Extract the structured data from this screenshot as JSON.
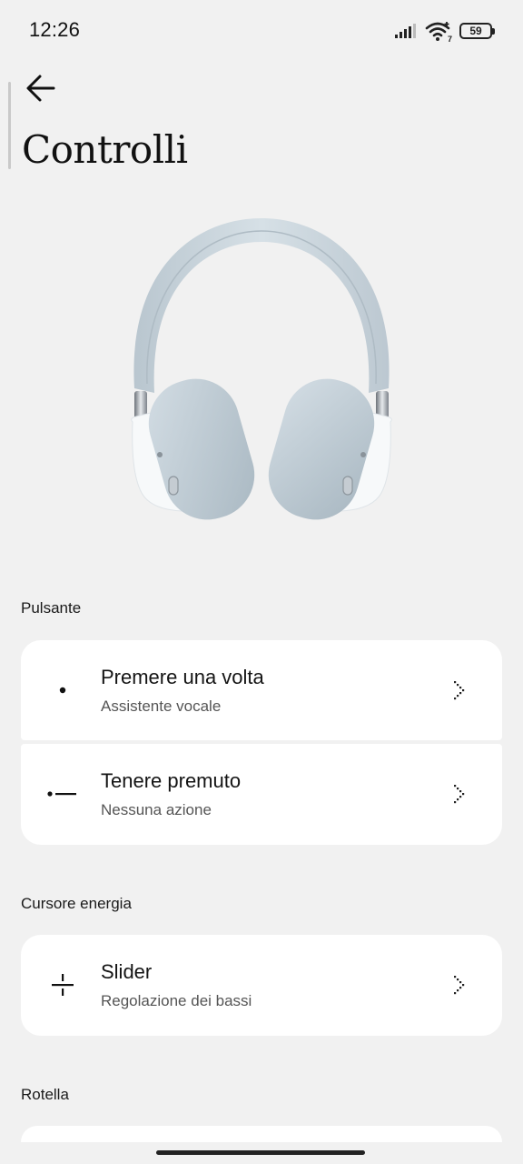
{
  "status_bar": {
    "time": "12:26",
    "battery_level": "59",
    "wifi_badge": "7"
  },
  "header": {
    "title": "Controlli"
  },
  "sections": {
    "button": {
      "label": "Pulsante",
      "items": [
        {
          "title": "Premere una volta",
          "subtitle": "Assistente vocale",
          "icon": "single-dot-icon"
        },
        {
          "title": "Tenere premuto",
          "subtitle": "Nessuna azione",
          "icon": "dot-dash-icon"
        }
      ]
    },
    "energy_slider": {
      "label": "Cursore energia",
      "items": [
        {
          "title": "Slider",
          "subtitle": "Regolazione dei bassi",
          "icon": "slider-icon"
        }
      ]
    },
    "wheel": {
      "label": "Rotella"
    }
  },
  "colors": {
    "background": "#f1f1f1",
    "card": "#ffffff",
    "text": "#141414",
    "subtext": "#555555"
  }
}
